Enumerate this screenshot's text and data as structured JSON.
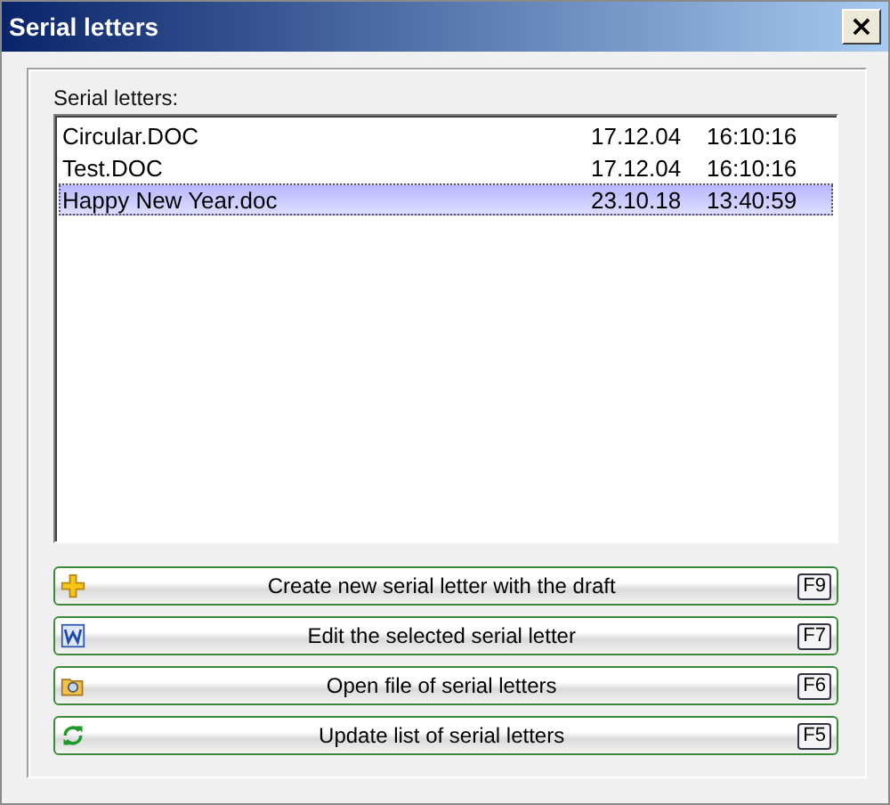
{
  "window": {
    "title": "Serial letters",
    "close": "×"
  },
  "list": {
    "label": "Serial letters:",
    "rows": [
      {
        "name": "Circular.DOC",
        "date": "17.12.04",
        "time": "16:10:16",
        "selected": false
      },
      {
        "name": "Test.DOC",
        "date": "17.12.04",
        "time": "16:10:16",
        "selected": false
      },
      {
        "name": "Happy New Year.doc",
        "date": "23.10.18",
        "time": "13:40:59",
        "selected": true
      }
    ]
  },
  "buttons": [
    {
      "kind": "add",
      "label": "Create new serial letter with the draft",
      "key": "F9"
    },
    {
      "kind": "word",
      "label": "Edit the selected serial letter",
      "key": "F7"
    },
    {
      "kind": "open",
      "label": "Open file of serial letters",
      "key": "F6"
    },
    {
      "kind": "refresh",
      "label": "Update list of serial letters",
      "key": "F5"
    }
  ]
}
